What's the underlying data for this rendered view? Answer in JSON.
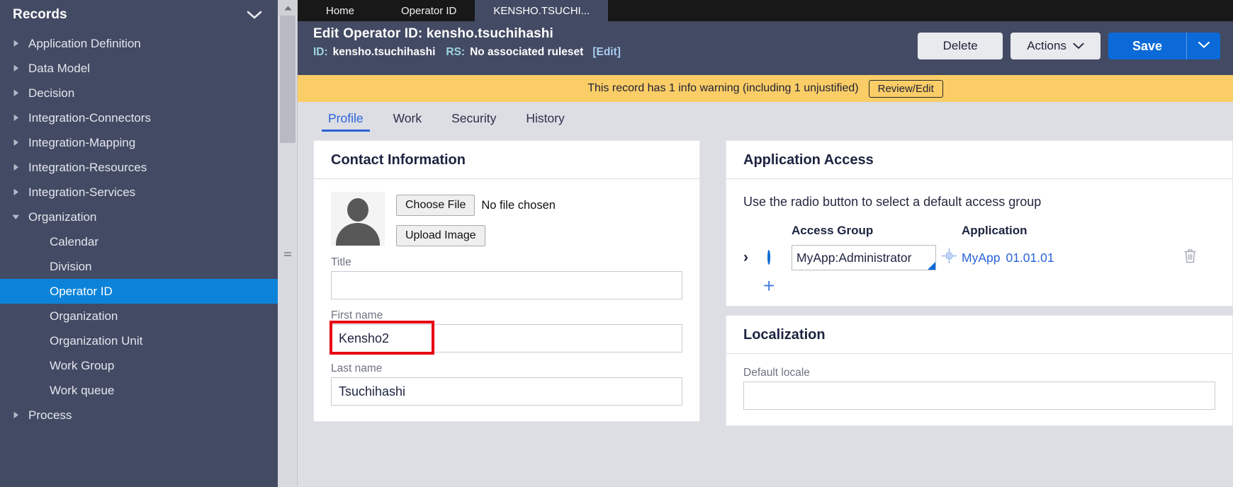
{
  "sidebar": {
    "title": "Records",
    "collapse_icon": "chevron-down-icon",
    "items": [
      {
        "label": "Application Definition",
        "level": 0,
        "expanded": false,
        "selected": false
      },
      {
        "label": "Data Model",
        "level": 0,
        "expanded": false,
        "selected": false
      },
      {
        "label": "Decision",
        "level": 0,
        "expanded": false,
        "selected": false
      },
      {
        "label": "Integration-Connectors",
        "level": 0,
        "expanded": false,
        "selected": false
      },
      {
        "label": "Integration-Mapping",
        "level": 0,
        "expanded": false,
        "selected": false
      },
      {
        "label": "Integration-Resources",
        "level": 0,
        "expanded": false,
        "selected": false
      },
      {
        "label": "Integration-Services",
        "level": 0,
        "expanded": false,
        "selected": false
      },
      {
        "label": "Organization",
        "level": 0,
        "expanded": true,
        "selected": false
      },
      {
        "label": "Calendar",
        "level": 1,
        "expanded": null,
        "selected": false
      },
      {
        "label": "Division",
        "level": 1,
        "expanded": null,
        "selected": false
      },
      {
        "label": "Operator ID",
        "level": 1,
        "expanded": null,
        "selected": true
      },
      {
        "label": "Organization",
        "level": 1,
        "expanded": null,
        "selected": false
      },
      {
        "label": "Organization Unit",
        "level": 1,
        "expanded": null,
        "selected": false
      },
      {
        "label": "Work Group",
        "level": 1,
        "expanded": null,
        "selected": false
      },
      {
        "label": "Work queue",
        "level": 1,
        "expanded": null,
        "selected": false
      },
      {
        "label": "Process",
        "level": 0,
        "expanded": false,
        "selected": false
      }
    ]
  },
  "window_tabs": [
    {
      "label": "Home",
      "active": false
    },
    {
      "label": "Operator ID",
      "active": false
    },
    {
      "label": "KENSHO.TSUCHI...",
      "active": true
    }
  ],
  "record_header": {
    "action": "Edit",
    "kind": "Operator ID: kensho.tsuchihashi",
    "id_label": "ID:",
    "id_value": "kensho.tsuchihashi",
    "rs_label": "RS:",
    "rs_value": "No associated ruleset",
    "edit_link": "[Edit]",
    "delete_label": "Delete",
    "actions_label": "Actions",
    "actions_caret_icon": "chevron-down-icon",
    "save_label": "Save",
    "save_caret_icon": "chevron-down-icon",
    "primary_color": "#0b6ad8"
  },
  "warning": {
    "text": "This record has 1 info warning (including 1 unjustified)",
    "button_label": "Review/Edit",
    "background": "#fbcd67"
  },
  "form_tabs": [
    {
      "label": "Profile",
      "active": true
    },
    {
      "label": "Work",
      "active": false
    },
    {
      "label": "Security",
      "active": false
    },
    {
      "label": "History",
      "active": false
    }
  ],
  "contact_card": {
    "title": "Contact Information",
    "avatar_icon": "user-avatar-icon",
    "choose_file_label": "Choose File",
    "no_file_text": "No file chosen",
    "upload_label": "Upload Image",
    "fields": [
      {
        "label": "Title",
        "value": "",
        "highlighted": false
      },
      {
        "label": "First name",
        "value": "Kensho2",
        "highlighted": true
      },
      {
        "label": "Last name",
        "value": "Tsuchihashi",
        "highlighted": false
      }
    ],
    "highlight_color": "#e60012"
  },
  "application_access": {
    "title": "Application Access",
    "note": "Use the radio button to select a default access group",
    "columns": {
      "access_group": "Access Group",
      "application": "Application"
    },
    "rows": [
      {
        "expand_icon": "chevron-right-icon",
        "selected": true,
        "access_group": "MyApp:Administrator",
        "app_icon": "target-icon",
        "application": "MyApp",
        "version": "01.01.01",
        "delete_icon": "trash-icon"
      }
    ],
    "add_icon": "plus-icon"
  },
  "localization": {
    "title": "Localization",
    "default_locale_label": "Default locale",
    "default_locale_value": ""
  }
}
